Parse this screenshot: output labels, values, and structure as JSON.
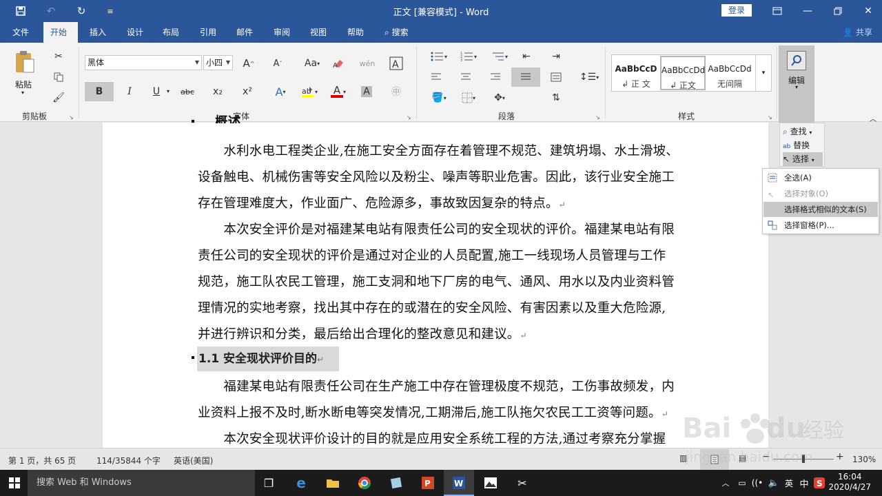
{
  "titlebar": {
    "title": "正文 [兼容模式] - Word",
    "login": "登录",
    "icons": [
      "save-icon",
      "undo-icon",
      "redo-icon",
      "customize-icon",
      "ribbon-display-icon",
      "minimize-icon",
      "restore-icon",
      "close-icon"
    ]
  },
  "tabs": [
    "文件",
    "开始",
    "插入",
    "设计",
    "布局",
    "引用",
    "邮件",
    "审阅",
    "视图",
    "帮助"
  ],
  "tellme": "搜索",
  "share": "共享",
  "ribbon": {
    "clipboard": {
      "paste": "粘贴",
      "label": "剪贴板"
    },
    "font": {
      "name": "黑体",
      "size": "小四",
      "label": "字体",
      "buttons": {
        "bold": "B",
        "italic": "I",
        "underline": "U",
        "strike": "abc",
        "sub": "x₂",
        "sup": "x²",
        "case": "Aa",
        "grow": "A",
        "shrink": "A",
        "text_effect": "A",
        "font_color": "A",
        "shade": "A",
        "border": "A"
      }
    },
    "paragraph": {
      "label": "段落"
    },
    "styles": {
      "label": "样式",
      "items": [
        {
          "preview": "AaBbCcD",
          "name": "↲ 正 文"
        },
        {
          "preview": "AaBbCcDd",
          "name": "↲ 正文"
        },
        {
          "preview": "AaBbCcDd",
          "name": "无间隔"
        }
      ]
    },
    "editing": {
      "label": "编辑"
    }
  },
  "find_panel": {
    "find": "查找",
    "replace": "替换",
    "select": "选择"
  },
  "select_menu": [
    {
      "label": "全选(A)",
      "disabled": false
    },
    {
      "label": "选择对象(O)",
      "disabled": true
    },
    {
      "label": "选择格式相似的文本(S)",
      "disabled": false
    },
    {
      "label": "选择窗格(P)...",
      "disabled": false
    }
  ],
  "document": {
    "top_fragment": "概述",
    "lines": [
      "　　水利水电工程类企业,在施工安全方面存在着管理不规范、建筑坍塌、水土滑坡、",
      "设备触电、机械伤害等安全风险以及粉尘、噪声等职业危害。因此，该行业安全施工",
      "存在管理难度大，作业面广、危险源多，事故致因复杂的特点。",
      "　　本次安全评价是对福建某电站有限责任公司的安全现状的评价。福建某电站有限",
      "责任公司的安全现状的评价是通过对企业的人员配置,施工一线现场人员管理与工作",
      "规范，施工队农民工管理，施工支洞和地下厂房的电气、通风、用水以及内业资料管",
      "理情况的实地考察，找出其中存在的或潜在的安全风险、有害因素以及重大危险源,",
      "并进行辨识和分类，最后给出合理化的整改意见和建议。"
    ],
    "heading": "1.1 安全现状评价目的",
    "lines2": [
      "　　福建某电站有限责任公司在生产施工中存在管理极度不规范，工伤事故频发，内",
      "业资料上报不及时,断水断电等突发情况,工期滞后,施工队拖欠农民工工资等问题。",
      "　　本次安全现状评价设计的目的就是应用安全系统工程的方法,通过考察充分掌握"
    ],
    "para_mark": "↵"
  },
  "status": {
    "page": "第 1 页，共 65 页",
    "words": "114/35844 个字",
    "lang": "英语(美国)",
    "zoom": "130%",
    "zoom_minus": "−",
    "zoom_plus": "+"
  },
  "taskbar": {
    "search": "搜索 Web 和 Windows",
    "ime": "中",
    "time": "16:04",
    "date": "2020/4/27"
  }
}
